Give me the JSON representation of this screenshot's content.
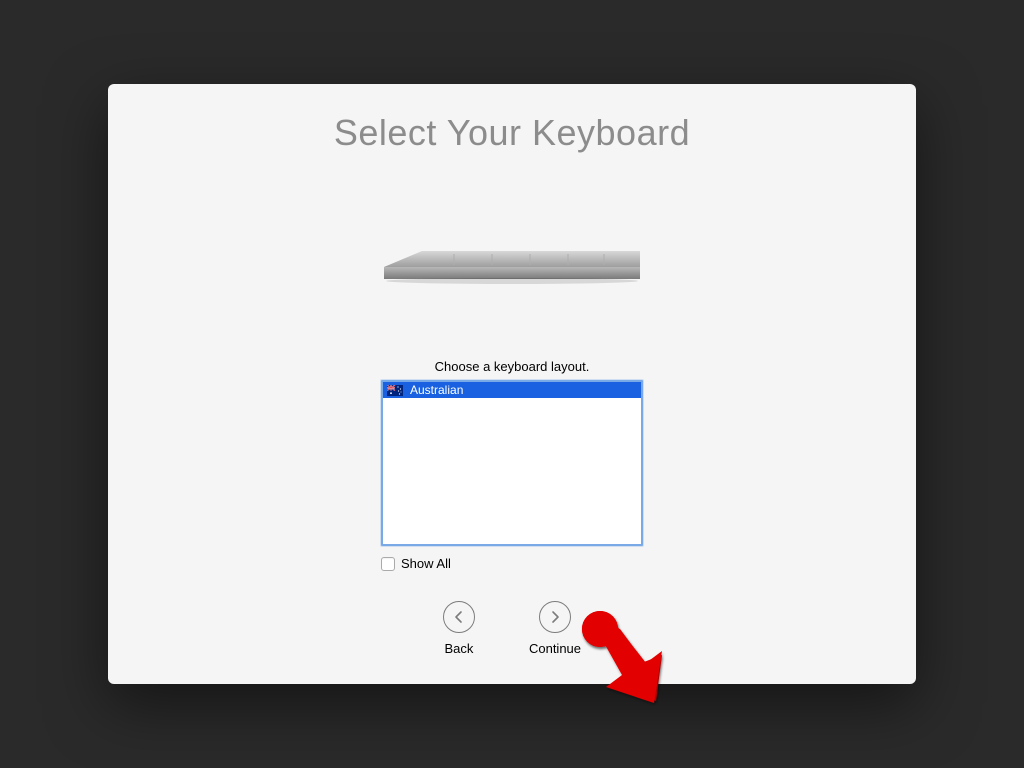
{
  "title": "Select Your Keyboard",
  "instruction": "Choose a keyboard layout.",
  "listbox": {
    "items": [
      {
        "label": "Australian",
        "selected": true,
        "flag": "au"
      }
    ]
  },
  "showall": {
    "label": "Show All",
    "checked": false
  },
  "nav": {
    "back": "Back",
    "continue": "Continue"
  }
}
